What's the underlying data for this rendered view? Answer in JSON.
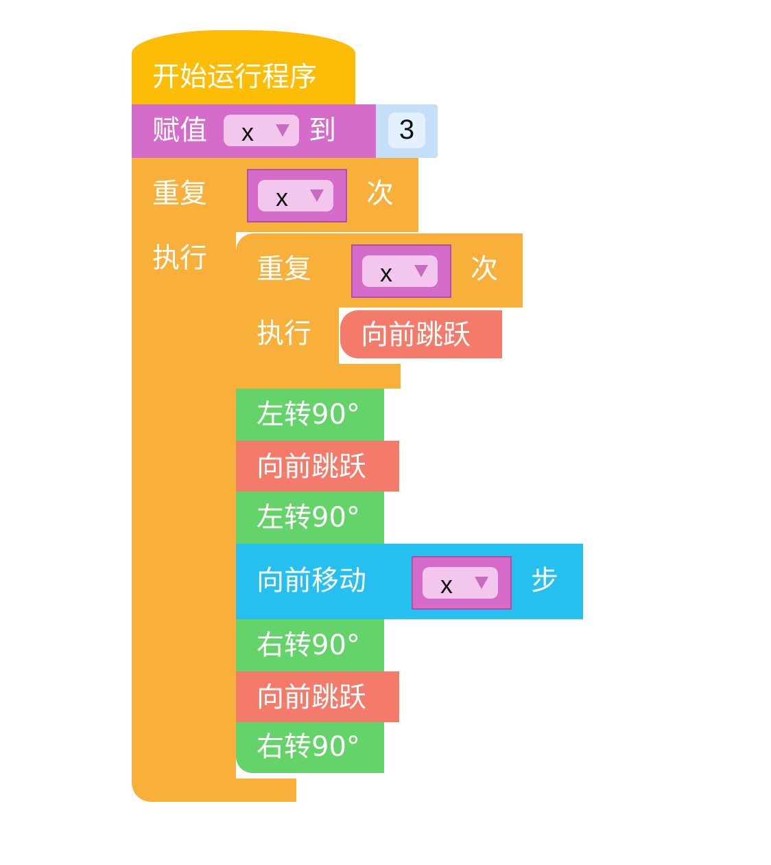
{
  "program": {
    "start_label": "开始运行程序",
    "assign": {
      "label": "赋值",
      "var": "x",
      "to": "到",
      "value": "3"
    },
    "outer_repeat": {
      "label": "重复",
      "var": "x",
      "times": "次",
      "do": "执行"
    },
    "inner_repeat": {
      "label": "重复",
      "var": "x",
      "times": "次",
      "do": "执行",
      "body": "向前跳跃"
    },
    "steps": [
      "左转90°",
      "向前跳跃",
      "左转90°",
      {
        "label": "向前移动",
        "var": "x",
        "unit": "步"
      },
      "右转90°",
      "向前跳跃",
      "右转90°"
    ]
  },
  "colors": {
    "start": "#fdbc06",
    "variable": "#d56cc9",
    "control": "#f9b03b",
    "turn": "#64d36a",
    "jump": "#f47a6a",
    "move": "#25c0ef"
  }
}
